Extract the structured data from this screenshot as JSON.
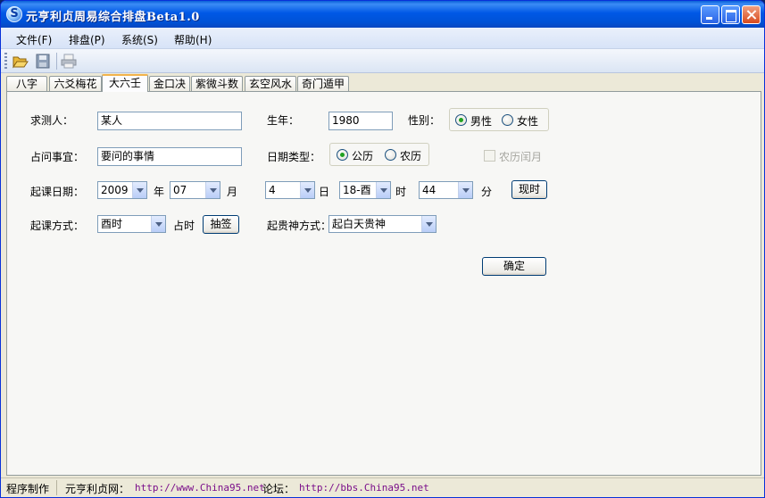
{
  "window": {
    "title": "元亨利贞周易综合排盘Beta1.0",
    "icon_letter": "S",
    "icon": "app-s-icon"
  },
  "menu": [
    {
      "label": "文件(F)"
    },
    {
      "label": "排盘(P)"
    },
    {
      "label": "系统(S)"
    },
    {
      "label": "帮助(H)"
    }
  ],
  "toolbar": {
    "icons": [
      "folder-open-icon",
      "save-icon",
      "print-icon"
    ]
  },
  "tabs": [
    {
      "label": "八字"
    },
    {
      "label": "六爻梅花"
    },
    {
      "label": "大六壬"
    },
    {
      "label": "金口决"
    },
    {
      "label": "紫微斗数"
    },
    {
      "label": "玄空风水"
    },
    {
      "label": "奇门遁甲"
    }
  ],
  "active_tab": "大六壬",
  "form": {
    "querent_label": "求测人：",
    "querent_value": "某人",
    "birth_year_label": "生年：",
    "birth_year_value": "1980",
    "gender_label": "性别：",
    "gender_male": "男性",
    "gender_female": "女性",
    "gender_selected": "男性",
    "matter_label": "占问事宜：",
    "matter_value": "要问的事情",
    "date_type_label": "日期类型：",
    "date_type_solar": "公历",
    "date_type_lunar": "农历",
    "date_type_selected": "公历",
    "leap_month_label": "农历闰月",
    "leap_month_checked": false,
    "start_date_label": "起课日期：",
    "year_value": "2009",
    "year_unit": "年",
    "month_value": "07",
    "month_unit": "月",
    "day_value": "4",
    "day_unit": "日",
    "hour_value": "18-酉",
    "hour_unit": "时",
    "minute_value": "44",
    "minute_unit": "分",
    "now_button": "现时",
    "method_label": "起课方式：",
    "method_value": "酉时",
    "method_suffix": "占时",
    "draw_button": "抽签",
    "noble_method_label": "起贵神方式：",
    "noble_method_value": "起白天贵神",
    "confirm_button": "确定"
  },
  "status": {
    "maker": "程序制作",
    "site_label": "元亨利贞网：",
    "site_url": "http://www.China95.net",
    "forum_label": "论坛：",
    "forum_url": "http://bbs.China95.net"
  },
  "colors": {
    "titlebar": "#0058e6",
    "link": "#7a0e8a",
    "active_tab_accent": "#f2b34b",
    "radio_dot": "#21a121"
  }
}
